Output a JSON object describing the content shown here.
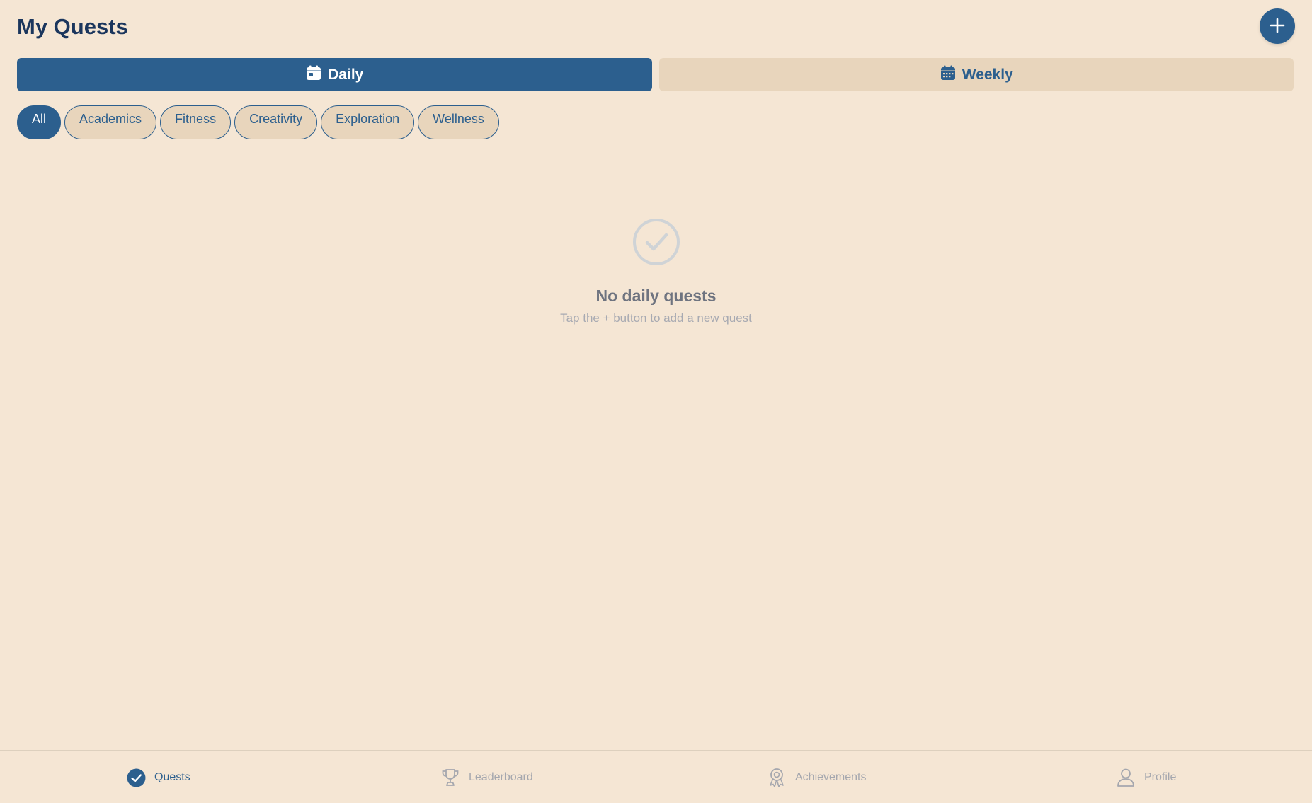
{
  "header": {
    "title": "My Quests",
    "add_button_icon": "plus-icon"
  },
  "period_tabs": [
    {
      "label": "Daily",
      "icon": "calendar-day-icon",
      "active": true
    },
    {
      "label": "Weekly",
      "icon": "calendar-week-icon",
      "active": false
    }
  ],
  "categories": [
    {
      "label": "All",
      "active": true
    },
    {
      "label": "Academics",
      "active": false
    },
    {
      "label": "Fitness",
      "active": false
    },
    {
      "label": "Creativity",
      "active": false
    },
    {
      "label": "Exploration",
      "active": false
    },
    {
      "label": "Wellness",
      "active": false
    }
  ],
  "empty_state": {
    "icon": "check-circle-icon",
    "title": "No daily quests",
    "subtitle": "Tap the + button to add a new quest"
  },
  "bottom_nav": [
    {
      "label": "Quests",
      "icon": "check-circle-icon",
      "active": true
    },
    {
      "label": "Leaderboard",
      "icon": "trophy-icon",
      "active": false
    },
    {
      "label": "Achievements",
      "icon": "award-ribbon-icon",
      "active": false
    },
    {
      "label": "Profile",
      "icon": "user-icon",
      "active": false
    }
  ],
  "colors": {
    "background": "#f5e6d4",
    "primary": "#2c5f8e",
    "title": "#1b365d",
    "chip_bg": "#e8d5bc",
    "muted_text": "#a8aab2"
  }
}
